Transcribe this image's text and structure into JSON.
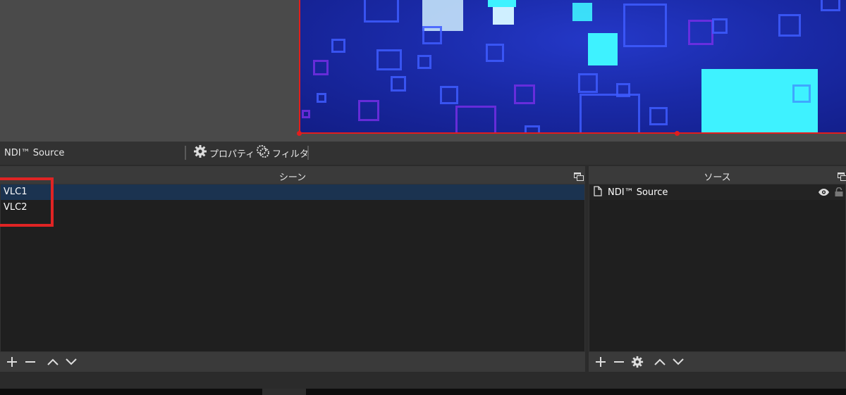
{
  "context_bar": {
    "source_name": "NDI™ Source",
    "properties_label": "プロパティ",
    "filters_label": "フィルタ"
  },
  "scenes": {
    "title": "シーン",
    "items": [
      {
        "label": "VLC1",
        "selected": true
      },
      {
        "label": "VLC2",
        "selected": false
      }
    ]
  },
  "sources": {
    "title": "ソース",
    "items": [
      {
        "label": "NDI™ Source",
        "visible": true,
        "locked": false
      }
    ]
  },
  "colors": {
    "accent_red": "#e21d1d",
    "selected_row": "#1b3350",
    "preview_blue": "#1a2aa8",
    "preview_cyan": "#3ef2ff"
  }
}
